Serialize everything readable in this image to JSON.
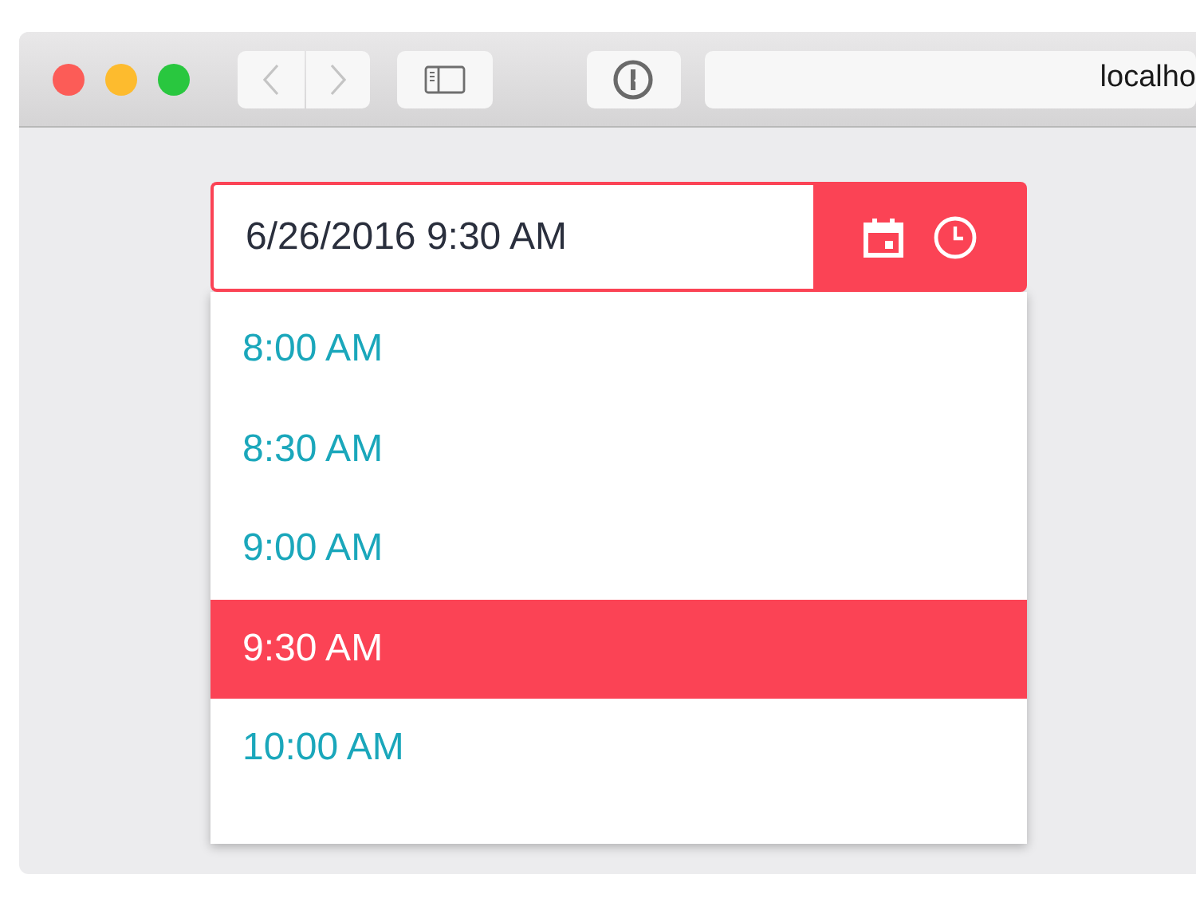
{
  "browser": {
    "address": "localho"
  },
  "picker": {
    "value": "6/26/2016 9:30 AM"
  },
  "time_list": [
    {
      "label": "8:00 AM",
      "selected": false
    },
    {
      "label": "8:30 AM",
      "selected": false
    },
    {
      "label": "9:00 AM",
      "selected": false
    },
    {
      "label": "9:30 AM",
      "selected": true
    },
    {
      "label": "10:00 AM",
      "selected": false
    }
  ]
}
